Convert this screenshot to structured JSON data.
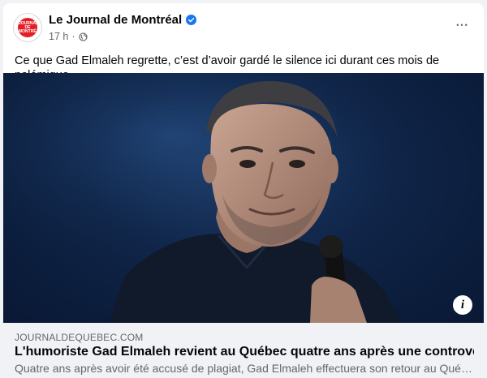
{
  "post": {
    "page_name": "Le Journal de Montréal",
    "avatar_text": "JOURNAL DE MONTRÉAL",
    "time": "17 h",
    "separator": "·",
    "caption": "Ce que Gad Elmaleh regrette, c’est d’avoir gardé le silence ici durant ces mois de polémique.",
    "more_label": "•••"
  },
  "link_preview": {
    "domain": "JOURNALDEQUEBEC.COM",
    "headline": "L'humoriste Gad Elmaleh revient au Québec quatre ans après une controverse",
    "description": "Quatre ans après avoir été accusé de plagiat, Gad Elmaleh effectuera son retour au Québec…",
    "info_label": "i"
  },
  "colors": {
    "background": "#f0f2f5",
    "card": "#ffffff",
    "verified_blue": "#1877f2",
    "brand_red": "#e41e26",
    "secondary_text": "#65676b",
    "primary_text": "#050505"
  },
  "icons": {
    "verified": "verified-badge-icon",
    "globe": "globe-icon",
    "more": "more-options-icon",
    "info": "info-icon"
  }
}
